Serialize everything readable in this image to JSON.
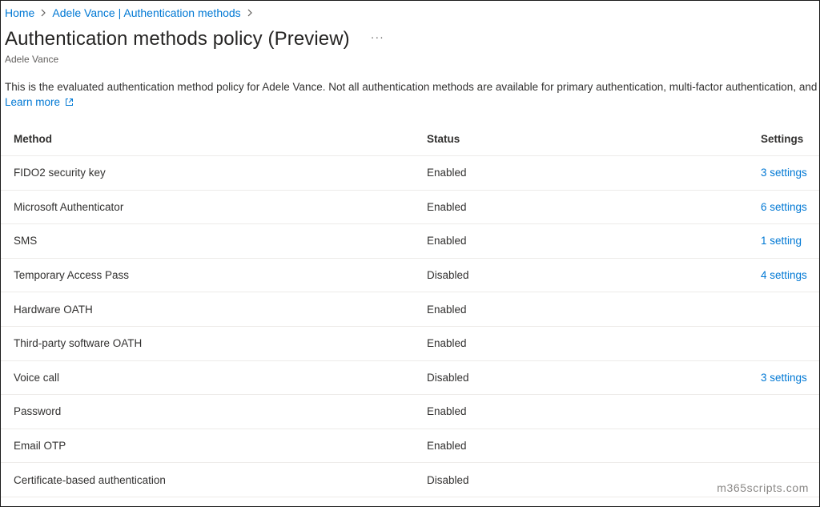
{
  "breadcrumb": {
    "home": "Home",
    "parent": "Adele Vance | Authentication methods"
  },
  "page": {
    "title": "Authentication methods policy (Preview)",
    "more": "···",
    "subtitle": "Adele Vance",
    "description": "This is the evaluated authentication method policy for Adele Vance. Not all authentication methods are available for primary authentication, multi-factor authentication, and self ser",
    "learn_more": "Learn more"
  },
  "table": {
    "headers": {
      "method": "Method",
      "status": "Status",
      "settings": "Settings"
    },
    "rows": [
      {
        "method": "FIDO2 security key",
        "status": "Enabled",
        "settings": "3 settings"
      },
      {
        "method": "Microsoft Authenticator",
        "status": "Enabled",
        "settings": "6 settings"
      },
      {
        "method": "SMS",
        "status": "Enabled",
        "settings": "1 setting"
      },
      {
        "method": "Temporary Access Pass",
        "status": "Disabled",
        "settings": "4 settings"
      },
      {
        "method": "Hardware OATH",
        "status": "Enabled",
        "settings": ""
      },
      {
        "method": "Third-party software OATH",
        "status": "Enabled",
        "settings": ""
      },
      {
        "method": "Voice call",
        "status": "Disabled",
        "settings": "3 settings"
      },
      {
        "method": "Password",
        "status": "Enabled",
        "settings": ""
      },
      {
        "method": "Email OTP",
        "status": "Enabled",
        "settings": ""
      },
      {
        "method": "Certificate-based authentication",
        "status": "Disabled",
        "settings": ""
      }
    ]
  },
  "watermark": "m365scripts.com",
  "colors": {
    "accent": "#0078d4",
    "text": "#323130",
    "muted": "#605e5c",
    "divider": "#edebe9"
  }
}
